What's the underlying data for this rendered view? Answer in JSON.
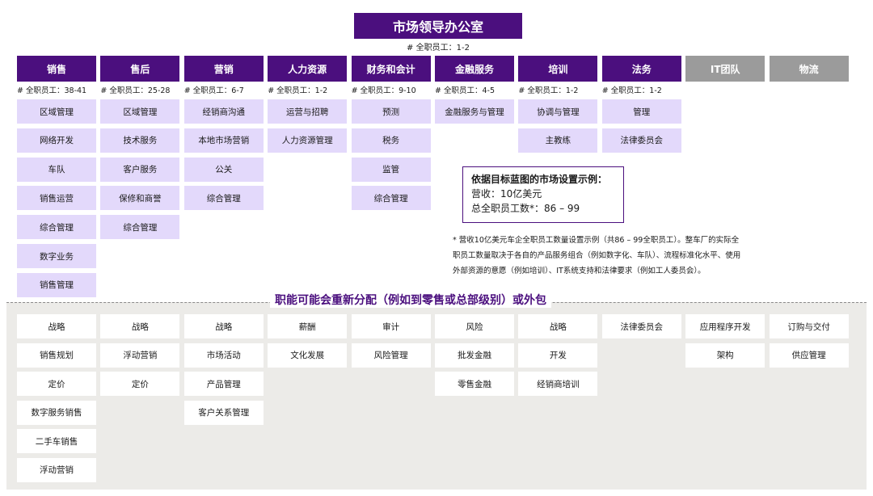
{
  "top": {
    "title": "市场领导办公室",
    "fte": "# 全职员工：1-2"
  },
  "departments": [
    {
      "name": "销售",
      "fte": "# 全职员工：38-41",
      "style": "primary",
      "functions": [
        "区域管理",
        "网络开发",
        "车队",
        "销售运营",
        "综合管理",
        "数字业务",
        "销售管理"
      ]
    },
    {
      "name": "售后",
      "fte": "# 全职员工：25-28",
      "style": "primary",
      "functions": [
        "区域管理",
        "技术服务",
        "客户服务",
        "保修和商誉",
        "综合管理"
      ]
    },
    {
      "name": "营销",
      "fte": "# 全职员工：6-7",
      "style": "primary",
      "functions": [
        "经销商沟通",
        "本地市场营销",
        "公关",
        "综合管理"
      ]
    },
    {
      "name": "人力资源",
      "fte": "# 全职员工：1-2",
      "style": "primary",
      "functions": [
        "运营与招聘",
        "人力资源管理"
      ]
    },
    {
      "name": "财务和会计",
      "fte": "# 全职员工：9-10",
      "style": "primary",
      "functions": [
        "预测",
        "税务",
        "监管",
        "综合管理"
      ]
    },
    {
      "name": "金融服务",
      "fte": "# 全职员工：4-5",
      "style": "primary",
      "functions": [
        "金融服务与管理"
      ]
    },
    {
      "name": "培训",
      "fte": "# 全职员工：1-2",
      "style": "primary",
      "functions": [
        "协调与管理",
        "主教练"
      ]
    },
    {
      "name": "法务",
      "fte": "# 全职员工：1-2",
      "style": "primary",
      "functions": [
        "管理",
        "法律委员会"
      ]
    },
    {
      "name": "IT团队",
      "fte": "",
      "style": "grey",
      "functions": []
    },
    {
      "name": "物流",
      "fte": "",
      "style": "grey",
      "functions": []
    }
  ],
  "example": {
    "heading": "依据目标蓝图的市场设置示例：",
    "revenue": "营收：10亿美元",
    "total_fte": "总全职员工数*：86 – 99"
  },
  "footnote": {
    "marker": "*",
    "lines": [
      "营收10亿美元车企全职员工数量设置示例（共86 – 99全职员工）。整车厂的实际全",
      "职员工数量取决于各自的产品服务组合（例如数字化、车队）、流程标准化水平、使用",
      "外部资源的意愿（例如培训）、IT系统支持和法律要求（例如工人委员会）。"
    ]
  },
  "reallocation": {
    "label": "职能可能会重新分配（例如到零售或总部级别）或外包",
    "columns": [
      [
        "战略",
        "销售规划",
        "定价",
        "数字服务销售",
        "二手车销售",
        "浮动营销"
      ],
      [
        "战略",
        "浮动营销",
        "定价"
      ],
      [
        "战略",
        "市场活动",
        "产品管理",
        "客户关系管理"
      ],
      [
        "薪酬",
        "文化发展"
      ],
      [
        "审计",
        "风险管理"
      ],
      [
        "风险",
        "批发金融",
        "零售金融"
      ],
      [
        "战略",
        "开发",
        "经销商培训"
      ],
      [
        "法律委员会"
      ],
      [
        "应用程序开发",
        "架构"
      ],
      [
        "订购与交付",
        "供应管理"
      ]
    ]
  },
  "colors": {
    "primary": "#4b0f7e",
    "grey_header": "#9b9b9b",
    "cell": "#e3d9fb",
    "band": "#ecebe8"
  }
}
